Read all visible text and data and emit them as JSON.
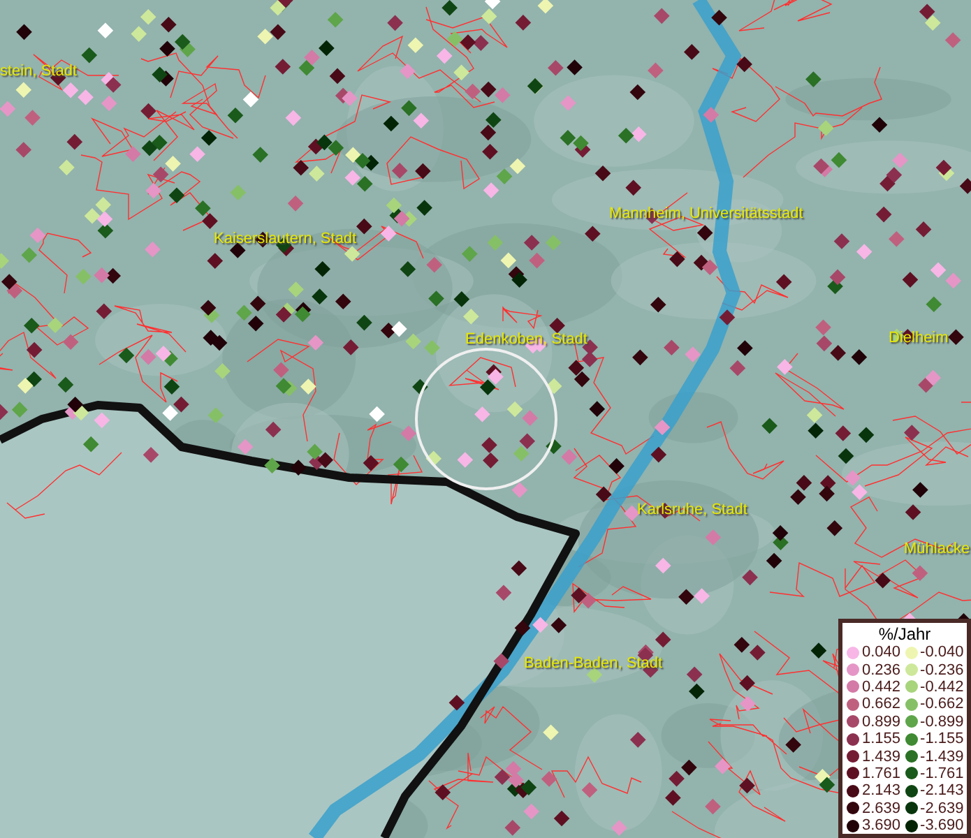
{
  "map_labels": [
    {
      "text": "stein, Stadt"
    },
    {
      "text": "Kaiserslautern, Stadt"
    },
    {
      "text": "Mannheim, Universitätsstadt"
    },
    {
      "text": "Edenkoben, Stadt"
    },
    {
      "text": "Dielheim"
    },
    {
      "text": "Karlsruhe, Stadt"
    },
    {
      "text": "Mühlacke"
    },
    {
      "text": "Baden-Baden, Stadt"
    }
  ],
  "legend": {
    "title": "%/Jahr",
    "positive": [
      {
        "value": "0.040",
        "color": "#f7b6e6"
      },
      {
        "value": "0.236",
        "color": "#e596c6"
      },
      {
        "value": "0.442",
        "color": "#d47aa6"
      },
      {
        "value": "0.662",
        "color": "#c0607f"
      },
      {
        "value": "0.899",
        "color": "#a84868"
      },
      {
        "value": "1.155",
        "color": "#8c3050"
      },
      {
        "value": "1.439",
        "color": "#751c35"
      },
      {
        "value": "1.761",
        "color": "#5e1022"
      },
      {
        "value": "2.143",
        "color": "#480a16"
      },
      {
        "value": "2.639",
        "color": "#33050d"
      },
      {
        "value": "3.690",
        "color": "#200208"
      }
    ],
    "negative": [
      {
        "value": "-0.040",
        "color": "#eef5b0"
      },
      {
        "value": "-0.236",
        "color": "#cde89a"
      },
      {
        "value": "-0.442",
        "color": "#a8d47c"
      },
      {
        "value": "-0.662",
        "color": "#86c066"
      },
      {
        "value": "-0.899",
        "color": "#5fa54a"
      },
      {
        "value": "-1.155",
        "color": "#3f8a32"
      },
      {
        "value": "-1.439",
        "color": "#2a7025"
      },
      {
        "value": "-1.761",
        "color": "#1a5a1a"
      },
      {
        "value": "-2.143",
        "color": "#0f4512"
      },
      {
        "value": "-2.639",
        "color": "#08350c"
      },
      {
        "value": "-3.690",
        "color": "#032506"
      }
    ]
  }
}
